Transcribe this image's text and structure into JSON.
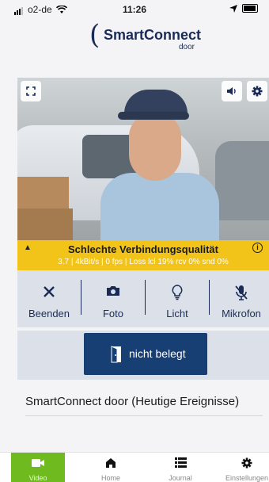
{
  "status_bar": {
    "carrier": "o2-de",
    "time": "11:26"
  },
  "header": {
    "logo_paren": "(",
    "logo_name": "SmartConnect",
    "logo_sub": "door"
  },
  "video": {
    "buttons": {
      "fullscreen": "fullscreen-icon",
      "speaker": "speaker-icon",
      "settings": "gear-icon"
    }
  },
  "quality": {
    "title": "Schlechte Verbindungsqualität",
    "stats": "3.7 | 4kBit/s | 0 fps | Loss lcl 19% rcv 0% snd 0%",
    "color": "#f2c318"
  },
  "controls": [
    {
      "id": "end",
      "label": "Beenden",
      "icon": "close-icon"
    },
    {
      "id": "photo",
      "label": "Foto",
      "icon": "camera-icon"
    },
    {
      "id": "light",
      "label": "Licht",
      "icon": "lightbulb-icon"
    },
    {
      "id": "mic",
      "label": "Mikrofon",
      "icon": "microphone-muted-icon"
    }
  ],
  "door": {
    "label": "nicht belegt",
    "color": "#173f73"
  },
  "events_title": "SmartConnect door (Heutige Ereignisse)",
  "tabs": [
    {
      "label": "Video",
      "icon": "video-camera-icon",
      "active": true
    },
    {
      "label": "Home",
      "icon": "home-icon",
      "active": false
    },
    {
      "label": "Journal",
      "icon": "list-icon",
      "active": false
    },
    {
      "label": "Einstellungen",
      "icon": "gear-icon",
      "active": false
    }
  ],
  "colors": {
    "brand": "#1a2b57",
    "active_tab": "#6fbb1f",
    "panel": "#dce1e9"
  }
}
